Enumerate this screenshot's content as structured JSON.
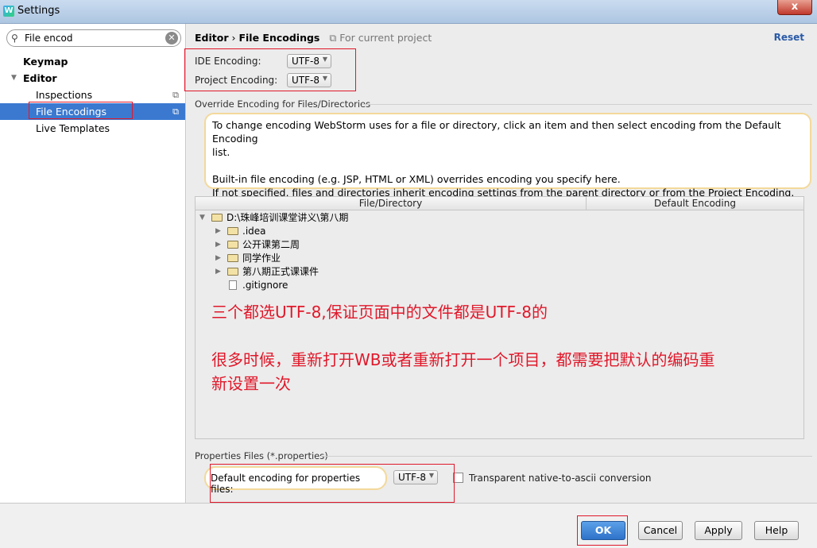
{
  "window": {
    "title": "Settings",
    "close_label": "x"
  },
  "left": {
    "search_value": "File encod",
    "items": [
      {
        "label": "Keymap"
      },
      {
        "label": "Editor"
      },
      {
        "label": "Inspections"
      },
      {
        "label": "File Encodings"
      },
      {
        "label": "Live Templates"
      }
    ]
  },
  "header": {
    "crumb_parent": "Editor",
    "crumb_sep": "›",
    "crumb_current": "File Encodings",
    "scope": "For current project",
    "reset": "Reset"
  },
  "encoding": {
    "ide_label": "IDE Encoding:",
    "ide_value": "UTF-8",
    "project_label": "Project Encoding:",
    "project_value": "UTF-8"
  },
  "override": {
    "title": "Override Encoding for Files/Directories",
    "info_line1": "To change encoding WebStorm uses for a file or directory, click an item and then select encoding from the Default Encoding",
    "info_line1b": "list.",
    "info_line2": "Built-in file encoding (e.g. JSP, HTML or XML) overrides encoding you specify here.",
    "info_line3": "If not specified, files and directories inherit encoding settings from the parent directory or from the Project Encoding."
  },
  "table": {
    "col_file": "File/Directory",
    "col_encoding": "Default Encoding",
    "root": "D:\\珠峰培训课堂讲义\\第八期",
    "children": [
      ".idea",
      "公开课第二周",
      "同学作业",
      "第八期正式课课件"
    ],
    "file": ".gitignore"
  },
  "annotation": {
    "line1": "三个都选UTF-8,保证页面中的文件都是UTF-8的",
    "line2": "很多时候，重新打开WB或者重新打开一个项目，都需要把默认的编码重",
    "line3": "新设置一次"
  },
  "properties": {
    "title": "Properties Files (*.properties)",
    "label": "Default encoding for properties files:",
    "value": "UTF-8",
    "checkbox_label": "Transparent native-to-ascii conversion"
  },
  "buttons": {
    "ok": "OK",
    "cancel": "Cancel",
    "apply": "Apply",
    "help": "Help"
  }
}
